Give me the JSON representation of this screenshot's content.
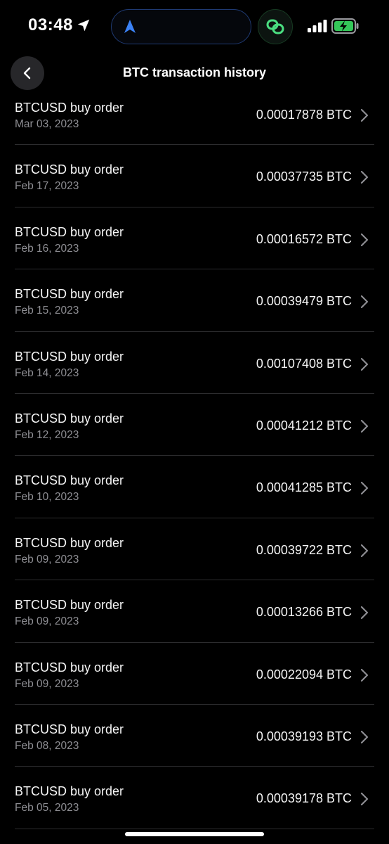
{
  "status_bar": {
    "time": "03:48",
    "icons": [
      "location-arrow-icon",
      "navigation-icon",
      "linked-rings-icon",
      "signal-icon",
      "battery-charging-icon"
    ]
  },
  "header": {
    "title": "BTC transaction history",
    "back_icon": "chevron-left-icon"
  },
  "transactions": [
    {
      "title": "BTCUSD buy order",
      "date": "Mar 03, 2023",
      "amount": "0.00017878 BTC"
    },
    {
      "title": "BTCUSD buy order",
      "date": "Feb 17, 2023",
      "amount": "0.00037735 BTC"
    },
    {
      "title": "BTCUSD buy order",
      "date": "Feb 16, 2023",
      "amount": "0.00016572 BTC"
    },
    {
      "title": "BTCUSD buy order",
      "date": "Feb 15, 2023",
      "amount": "0.00039479 BTC"
    },
    {
      "title": "BTCUSD buy order",
      "date": "Feb 14, 2023",
      "amount": "0.00107408 BTC"
    },
    {
      "title": "BTCUSD buy order",
      "date": "Feb 12, 2023",
      "amount": "0.00041212 BTC"
    },
    {
      "title": "BTCUSD buy order",
      "date": "Feb 10, 2023",
      "amount": "0.00041285 BTC"
    },
    {
      "title": "BTCUSD buy order",
      "date": "Feb 09, 2023",
      "amount": "0.00039722 BTC"
    },
    {
      "title": "BTCUSD buy order",
      "date": "Feb 09, 2023",
      "amount": "0.00013266 BTC"
    },
    {
      "title": "BTCUSD buy order",
      "date": "Feb 09, 2023",
      "amount": "0.00022094 BTC"
    },
    {
      "title": "BTCUSD buy order",
      "date": "Feb 08, 2023",
      "amount": "0.00039193 BTC"
    },
    {
      "title": "BTCUSD buy order",
      "date": "Feb 05, 2023",
      "amount": "0.00039178 BTC"
    }
  ],
  "colors": {
    "background": "#000000",
    "divider": "#2c2c2e",
    "secondary_text": "#8e8e93",
    "back_button_bg": "#27272a",
    "island_border": "#1f3a73",
    "nav_arrow": "#3b82f6",
    "link_icon_green": "#4ade80",
    "battery_green": "#34c759"
  }
}
